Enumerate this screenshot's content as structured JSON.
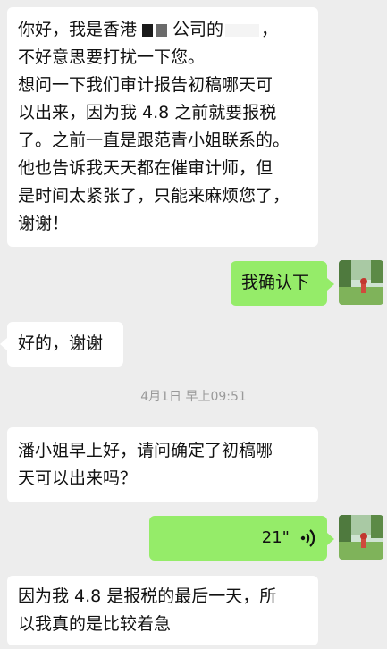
{
  "messages": [
    {
      "side": "left",
      "lines": [
        "你好，我是香港",
        "公司的",
        "，",
        "不好意思要打扰一下您。",
        "想问一下我们审计报告初稿哪天可",
        "以出来，因为我 4.8 之前就要报税",
        "了。之前一直是跟范青小姐联系的。",
        "他也告诉我天天都在催审计师，但",
        "是时间太紧张了，只能来麻烦您了，",
        "谢谢！"
      ]
    },
    {
      "side": "right",
      "text": "我确认下"
    },
    {
      "side": "left",
      "text": "好的，谢谢"
    },
    {
      "side": "left",
      "lines": [
        "潘小姐早上好，请问确定了初稿哪",
        "天可以出来吗？"
      ]
    },
    {
      "side": "right",
      "voice_duration": "21\"",
      "voice_icon": "voice-wave-icon"
    },
    {
      "side": "left",
      "lines": [
        "因为我 4.8 是报税的最后一天，所",
        "以我真的是比较着急"
      ]
    }
  ],
  "timestamp": "4月1日 早上09:51",
  "colors": {
    "background": "#ededed",
    "bubble_left": "#ffffff",
    "bubble_right": "#95ec69"
  }
}
